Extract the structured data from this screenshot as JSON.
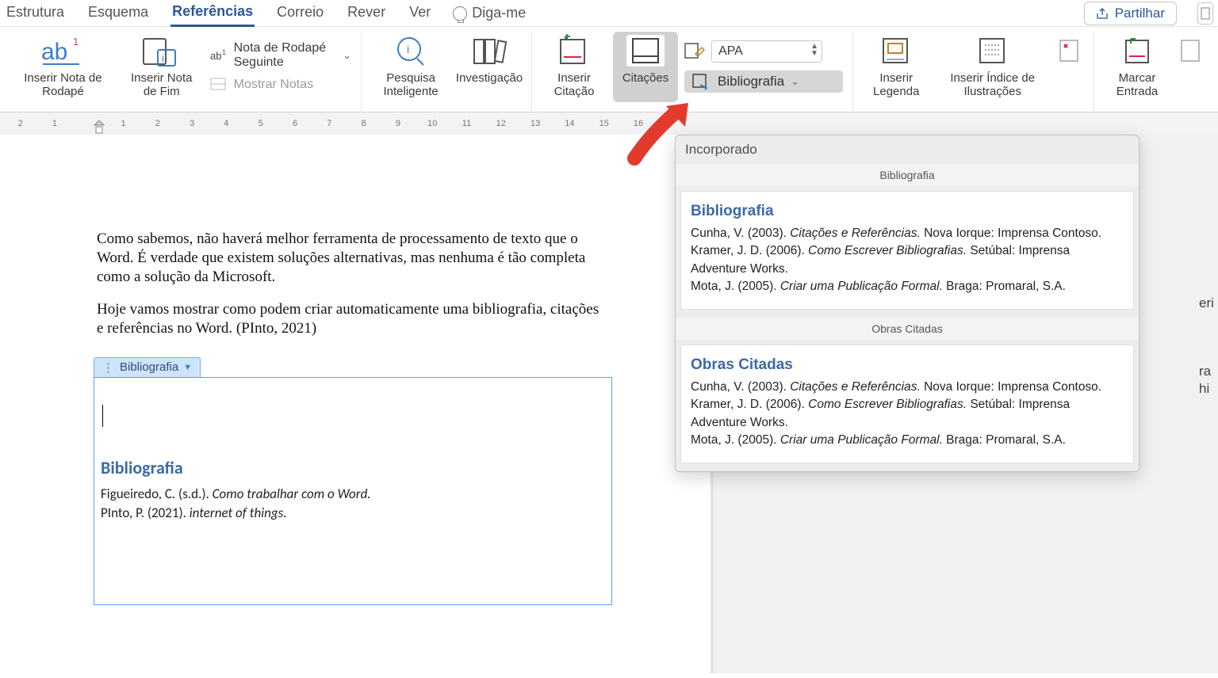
{
  "tabs": {
    "items": [
      "Estrutura",
      "Esquema",
      "Referências",
      "Correio",
      "Rever",
      "Ver"
    ],
    "active_index": 2,
    "tell_me": "Diga-me",
    "share": "Partilhar"
  },
  "ribbon": {
    "insert_footnote": "Inserir Nota de Rodapé",
    "insert_endnote": "Inserir Nota de Fim",
    "next_footnote": "Nota de Rodapé Seguinte",
    "show_notes": "Mostrar Notas",
    "smart_lookup": "Pesquisa Inteligente",
    "researcher": "Investigação",
    "insert_citation": "Inserir Citação",
    "citations": "Citações",
    "style_label": "APA",
    "bibliography": "Bibliografia",
    "insert_caption": "Inserir Legenda",
    "insert_table_fig": "Inserir Índice de Ilustrações",
    "mark_entry": "Marcar Entrada"
  },
  "document": {
    "para1": "Como sabemos, não haverá melhor ferramenta de processamento de texto que o Word. É verdade que existem soluções alternativas, mas nenhuma é tão completa como a solução da Microsoft.",
    "para2": "Hoje vamos mostrar como podem criar automaticamente uma bibliografia, citações e referências no Word. (PInto, 2021)",
    "field_tab": "Bibliografia",
    "field_title": "Bibliografia",
    "entries": [
      {
        "pre": "Figueiredo, C. (s.d.). ",
        "ital": "Como trabalhar com o Word.",
        "post": ""
      },
      {
        "pre": "PInto, P. (2021). ",
        "ital": "internet of things.",
        "post": ""
      }
    ]
  },
  "dropdown": {
    "header": "Incorporado",
    "sections": [
      {
        "label": "Bibliografia",
        "title": "Bibliografia",
        "lines": [
          {
            "pre": "Cunha, V. (2003). ",
            "ital": "Citações e Referências.",
            "post": " Nova Iorque: Imprensa Contoso."
          },
          {
            "pre": "Kramer, J. D. (2006). ",
            "ital": "Como Escrever Bibliografias.",
            "post": " Setúbal: Imprensa Adventure Works."
          },
          {
            "pre": "Mota, J. (2005). ",
            "ital": "Criar uma Publicação Formal.",
            "post": " Braga: Promaral, S.A."
          }
        ]
      },
      {
        "label": "Obras Citadas",
        "title": "Obras Citadas",
        "lines": [
          {
            "pre": "Cunha, V. (2003). ",
            "ital": "Citações e Referências.",
            "post": " Nova Iorque: Imprensa Contoso."
          },
          {
            "pre": "Kramer, J. D. (2006). ",
            "ital": "Como Escrever Bibliografias.",
            "post": " Setúbal: Imprensa Adventure Works."
          },
          {
            "pre": "Mota, J. (2005). ",
            "ital": "Criar uma Publicação Formal.",
            "post": " Braga: Promaral, S.A."
          }
        ]
      }
    ]
  },
  "ruler": {
    "numbers": [
      "2",
      "1",
      "",
      "1",
      "2",
      "3",
      "4",
      "5",
      "6",
      "7",
      "8",
      "9",
      "10",
      "11",
      "12",
      "13",
      "14",
      "15",
      "16"
    ]
  },
  "clipped": [
    "eri",
    "ra",
    "hi"
  ]
}
